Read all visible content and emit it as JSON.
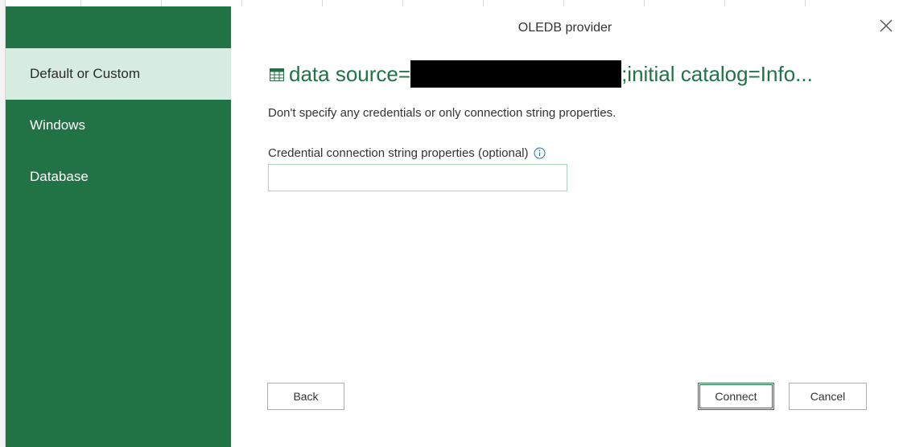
{
  "dialog": {
    "title": "OLEDB provider",
    "close_icon": "close-icon"
  },
  "sidebar": {
    "items": [
      {
        "label": "Default or Custom",
        "selected": true
      },
      {
        "label": "Windows",
        "selected": false
      },
      {
        "label": "Database",
        "selected": false
      }
    ]
  },
  "main": {
    "heading_icon": "table-icon",
    "heading_prefix": "data source=",
    "heading_suffix": ";initial catalog=Info...",
    "description": "Don't specify any credentials or only connection string properties.",
    "field_label": "Credential connection string properties (optional)",
    "field_value": "",
    "info_icon": "info-icon"
  },
  "buttons": {
    "back": "Back",
    "connect": "Connect",
    "cancel": "Cancel"
  },
  "colors": {
    "accent": "#217346",
    "sidebar_selected": "#d6ece0"
  }
}
